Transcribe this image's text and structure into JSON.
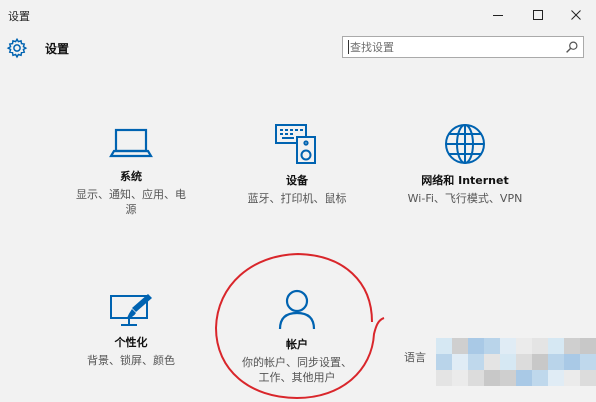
{
  "window": {
    "title": "设置",
    "controls": {
      "minimize": "minimize-icon",
      "maximize": "maximize-icon",
      "close": "close-icon"
    }
  },
  "header": {
    "icon": "gear-icon",
    "title": "设置"
  },
  "search": {
    "placeholder": "查找设置",
    "icon": "search-icon"
  },
  "tiles": [
    {
      "icon": "laptop-icon",
      "title": "系统",
      "desc": [
        "显示、通知、应用、电",
        "源"
      ]
    },
    {
      "icon": "keyboard-speaker-icon",
      "title": "设备",
      "desc": [
        "蓝牙、打印机、鼠标"
      ]
    },
    {
      "icon": "globe-icon",
      "title": "网络和 Internet",
      "desc": [
        "Wi-Fi、飞行模式、VPN"
      ]
    },
    {
      "icon": "paint-monitor-icon",
      "title": "个性化",
      "desc": [
        "背景、锁屏、颜色"
      ]
    },
    {
      "icon": "person-icon",
      "title": "帐户",
      "desc": [
        "你的帐户、同步设置、",
        "工作、其他用户"
      ]
    },
    {
      "icon": "",
      "title": "",
      "desc": [
        "语言"
      ]
    }
  ],
  "colors": {
    "accent": "#0063b1",
    "background": "#f2f2f2",
    "annotation": "#d9262b"
  }
}
